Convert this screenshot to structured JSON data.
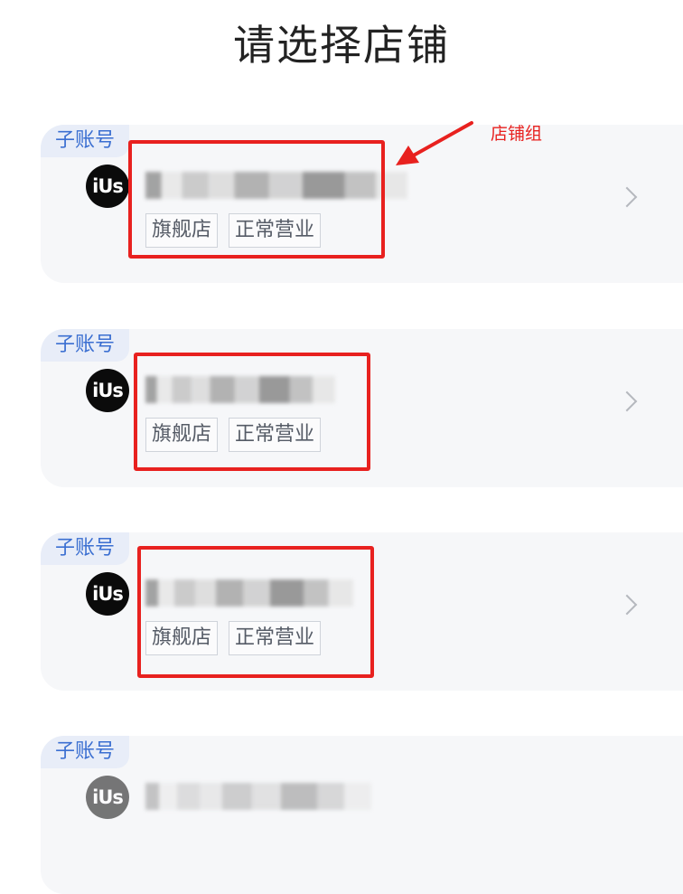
{
  "page": {
    "title": "请选择店铺"
  },
  "annotation": {
    "label": "店铺组",
    "color": "#e8211f"
  },
  "stores": [
    {
      "badge": "子账号",
      "avatar_text": "iUs",
      "tags": [
        "旗舰店",
        "正常营业"
      ]
    },
    {
      "badge": "子账号",
      "avatar_text": "iUs",
      "tags": [
        "旗舰店",
        "正常营业"
      ]
    },
    {
      "badge": "子账号",
      "avatar_text": "iUs",
      "tags": [
        "旗舰店",
        "正常营业"
      ]
    },
    {
      "badge": "子账号",
      "avatar_text": "iUs"
    }
  ],
  "icons": {
    "avatar": "store-logo-icon",
    "chevron": "chevron-right-icon"
  }
}
